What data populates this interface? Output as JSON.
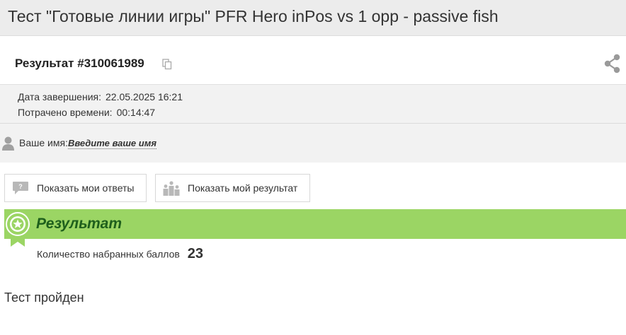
{
  "page": {
    "title": "Тест \"Готовые линии игры\" PFR Hero inPos vs 1 opp - passive fish"
  },
  "result": {
    "title": "Результат #310061989",
    "copy_icon": "copy-icon",
    "share_icon": "share-icon"
  },
  "meta": {
    "finished_label": "Дата завершения:",
    "finished_value": "22.05.2025 16:21",
    "time_label": "Потрачено времени:",
    "time_value": "00:14:47"
  },
  "user": {
    "icon": "user-icon",
    "name_label": "Ваше имя:",
    "name_placeholder": "Введите ваше имя"
  },
  "buttons": {
    "show_answers": "Показать мои ответы",
    "show_result": "Показать мой результат"
  },
  "summary": {
    "banner_title": "Результат",
    "score_label": "Количество набранных баллов",
    "score_value": "23",
    "status": "Тест пройден"
  },
  "colors": {
    "banner_bg": "#9bd564",
    "banner_text": "#1e5f1c",
    "header_bg": "#ececec",
    "meta_bg": "#f2f2f2"
  }
}
